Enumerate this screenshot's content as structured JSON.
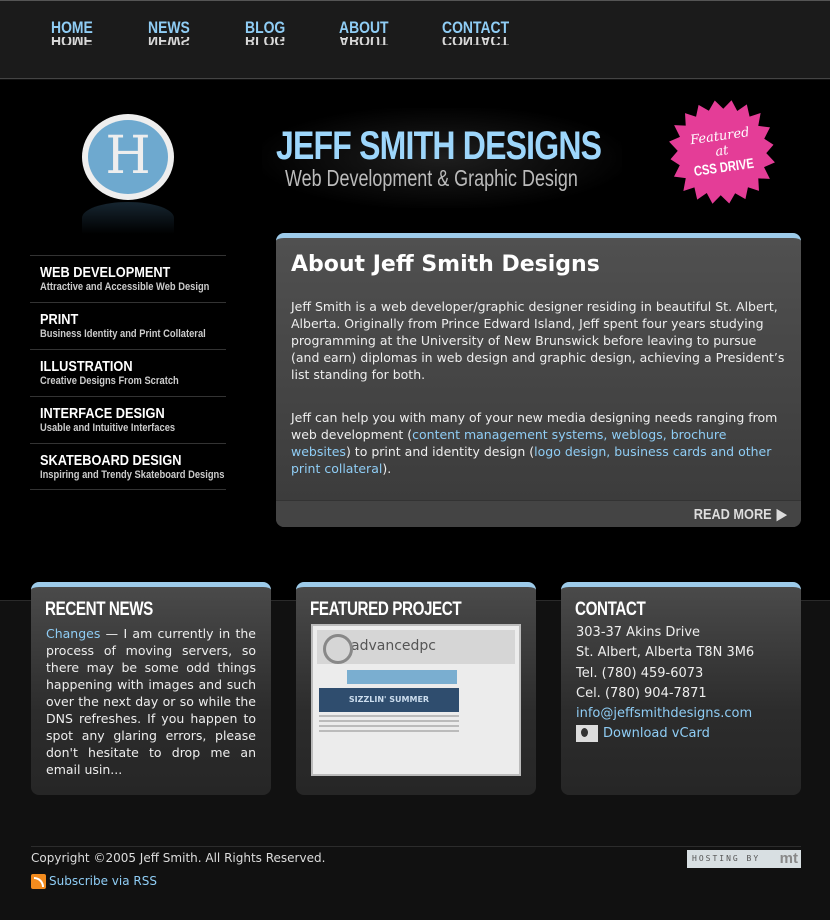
{
  "nav": [
    "HOME",
    "NEWS",
    "BLOG",
    "ABOUT",
    "CONTACT"
  ],
  "header": {
    "logo_letter": "H",
    "title": "JEFF SMITH DESIGNS",
    "subtitle": "Web Development & Graphic Design",
    "badge": {
      "line1": "Featured",
      "line2": "at",
      "line3": "CSS DRIVE",
      "color": "#e43d97"
    }
  },
  "sidebar": [
    {
      "title": "WEB DEVELOPMENT",
      "sub": "Attractive and Accessible Web Design"
    },
    {
      "title": "PRINT",
      "sub": "Business Identity and Print Collateral"
    },
    {
      "title": "ILLUSTRATION",
      "sub": "Creative Designs From Scratch"
    },
    {
      "title": "INTERFACE DESIGN",
      "sub": "Usable and Intuitive Interfaces"
    },
    {
      "title": "SKATEBOARD DESIGN",
      "sub": "Inspiring and Trendy Skateboard Designs"
    }
  ],
  "about": {
    "title": "About Jeff Smith Designs",
    "p1": "Jeff Smith is a web developer/graphic designer residing in beautiful St. Albert, Alberta. Originally from Prince Edward Island, Jeff spent four years studying programming at the University of New Brunswick before leaving to pursue (and earn) diplomas in web design and graphic design, achieving a President’s list standing for both.",
    "p2_a": "Jeff can help you with many of your new media designing needs ranging from web development (",
    "link1": "content management systems, weblogs, brochure websites",
    "p2_b": ") to print and identity design (",
    "link2": "logo design, business cards and other print collateral",
    "p2_c": ").",
    "read_more": "READ MORE"
  },
  "news": {
    "title": "RECENT NEWS",
    "link": "Changes",
    "text": " — I am currently in the process of moving servers, so there may be some odd things happening with images and such over the next day or so while the DNS refreshes. If you happen to spot any glaring errors, please don't hesitate to drop me an email usin..."
  },
  "project": {
    "title": "FEATURED PROJECT",
    "shot_brand": "advancedpc",
    "shot_banner": "SIZZLIN' SUMMER"
  },
  "contact": {
    "title": "CONTACT",
    "address1": "303-37 Akins Drive",
    "address2": "St. Albert, Alberta T8N 3M6",
    "tel": "Tel. (780) 459-6073",
    "cel": "Cel. (780) 904-7871",
    "email": "info@jeffsmithdesigns.com",
    "vcard": "Download vCard"
  },
  "footer": {
    "copyright": "Copyright ©2005 Jeff Smith. All Rights Reserved.",
    "rss": "Subscribe via RSS",
    "hosting": "HOSTING BY",
    "hosting_logo": "mt"
  },
  "colors": {
    "accent": "#8fcdf5",
    "box_top": "#9dcbea"
  }
}
